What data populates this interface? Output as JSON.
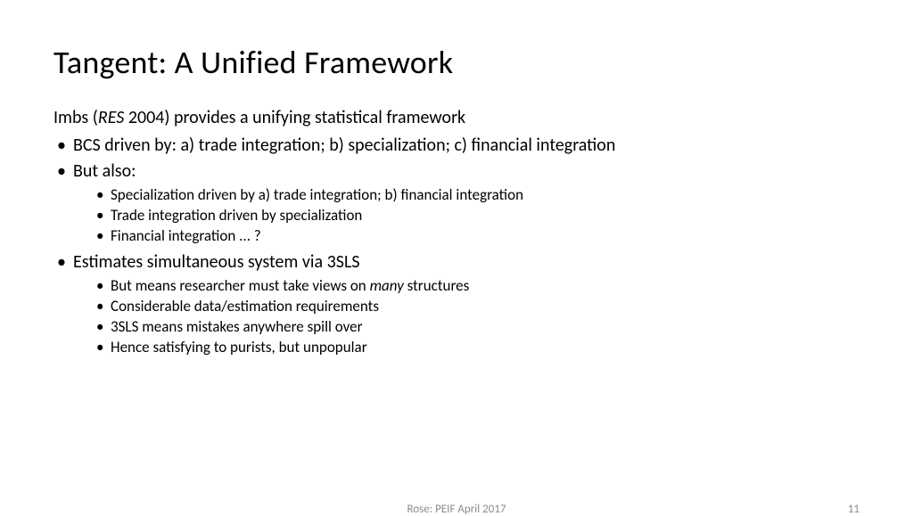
{
  "title": "Tangent: A Unified Framework",
  "intro_prefix": "Imbs (",
  "intro_italic": "RES",
  "intro_suffix": " 2004) provides a unifying statistical framework",
  "bullets": {
    "b1": "BCS driven by: a) trade integration; b) specialization; c) financial integration",
    "b2": "But also:",
    "b2_sub": {
      "s1": "Specialization driven by a) trade integration; b) financial integration",
      "s2": "Trade integration driven by specialization",
      "s3": "Financial integration ... ?"
    },
    "b3": "Estimates simultaneous system via 3SLS",
    "b3_sub": {
      "s1_prefix": "But means researcher must take views on ",
      "s1_italic": "many",
      "s1_suffix": " structures",
      "s2": "Considerable data/estimation requirements",
      "s3": "3SLS means mistakes anywhere spill over",
      "s4": "Hence satisfying to purists, but unpopular"
    }
  },
  "footer": {
    "center": "Rose: PEIF April 2017",
    "page": "11"
  }
}
